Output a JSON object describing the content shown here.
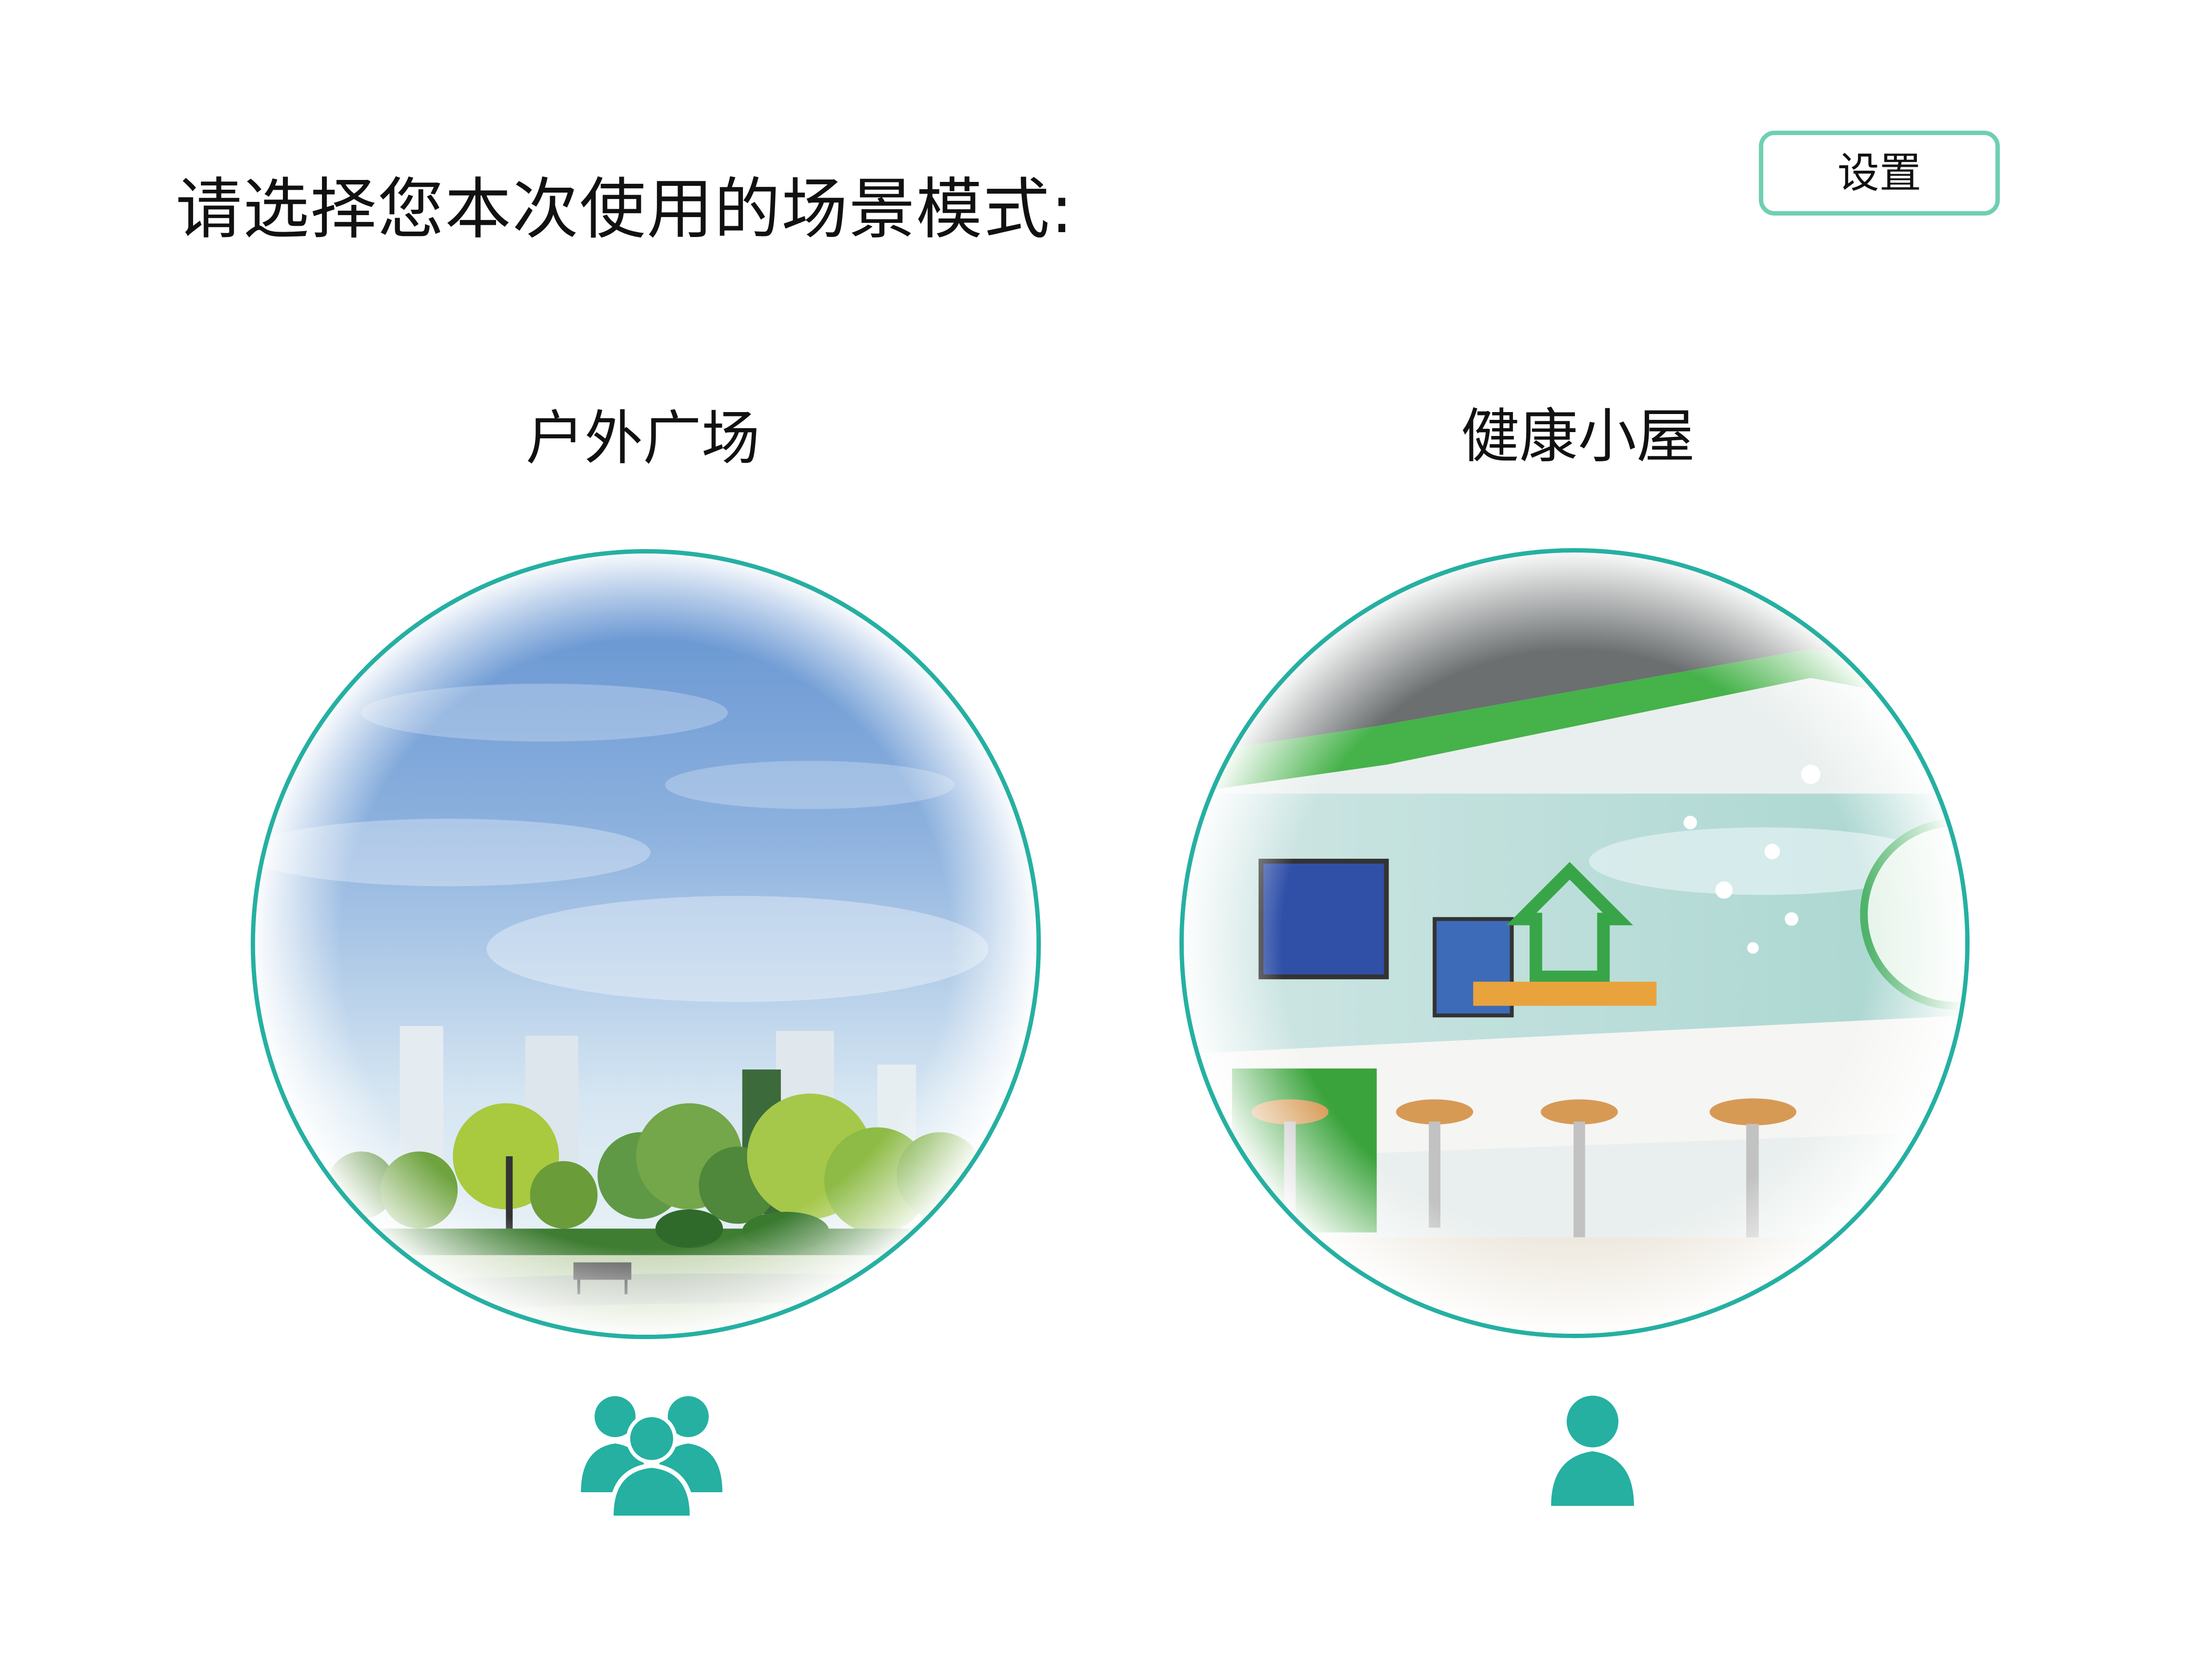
{
  "page": {
    "title": "请选择您本次使用的场景模式:"
  },
  "toolbar": {
    "settings_label": "设置"
  },
  "modes": [
    {
      "label": "户外广场",
      "scene": "outdoor-plaza-photo",
      "icon": "people-group-icon"
    },
    {
      "label": "健康小屋",
      "scene": "health-cabin-photo",
      "icon": "person-icon"
    }
  ],
  "colors": {
    "accent": "#25b0a2",
    "settings_border": "#6fcfb2",
    "text": "#111111"
  }
}
